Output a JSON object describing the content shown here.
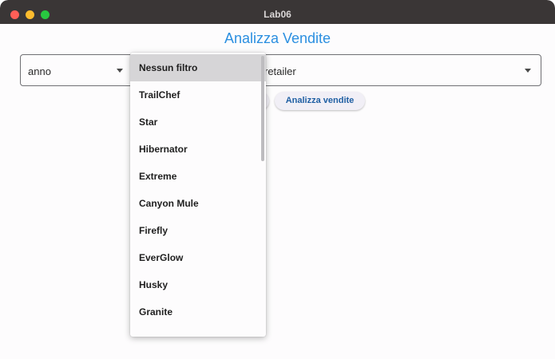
{
  "window": {
    "title": "Lab06"
  },
  "page": {
    "title": "Analizza Vendite"
  },
  "filters": {
    "anno": {
      "value": "anno"
    },
    "retailer": {
      "value": "retailer"
    }
  },
  "actions": {
    "analizza_label": "Analizza vendite"
  },
  "brand_dropdown": {
    "selected": "Nessun filtro",
    "options": [
      "Nessun filtro",
      "TrailChef",
      "Star",
      "Hibernator",
      "Extreme",
      "Canyon Mule",
      "Firefly",
      "EverGlow",
      "Husky",
      "Granite"
    ]
  },
  "colors": {
    "accent": "#2b8fe0",
    "titlebar": "#3a3636",
    "selected_item": "#d6d5d7"
  }
}
